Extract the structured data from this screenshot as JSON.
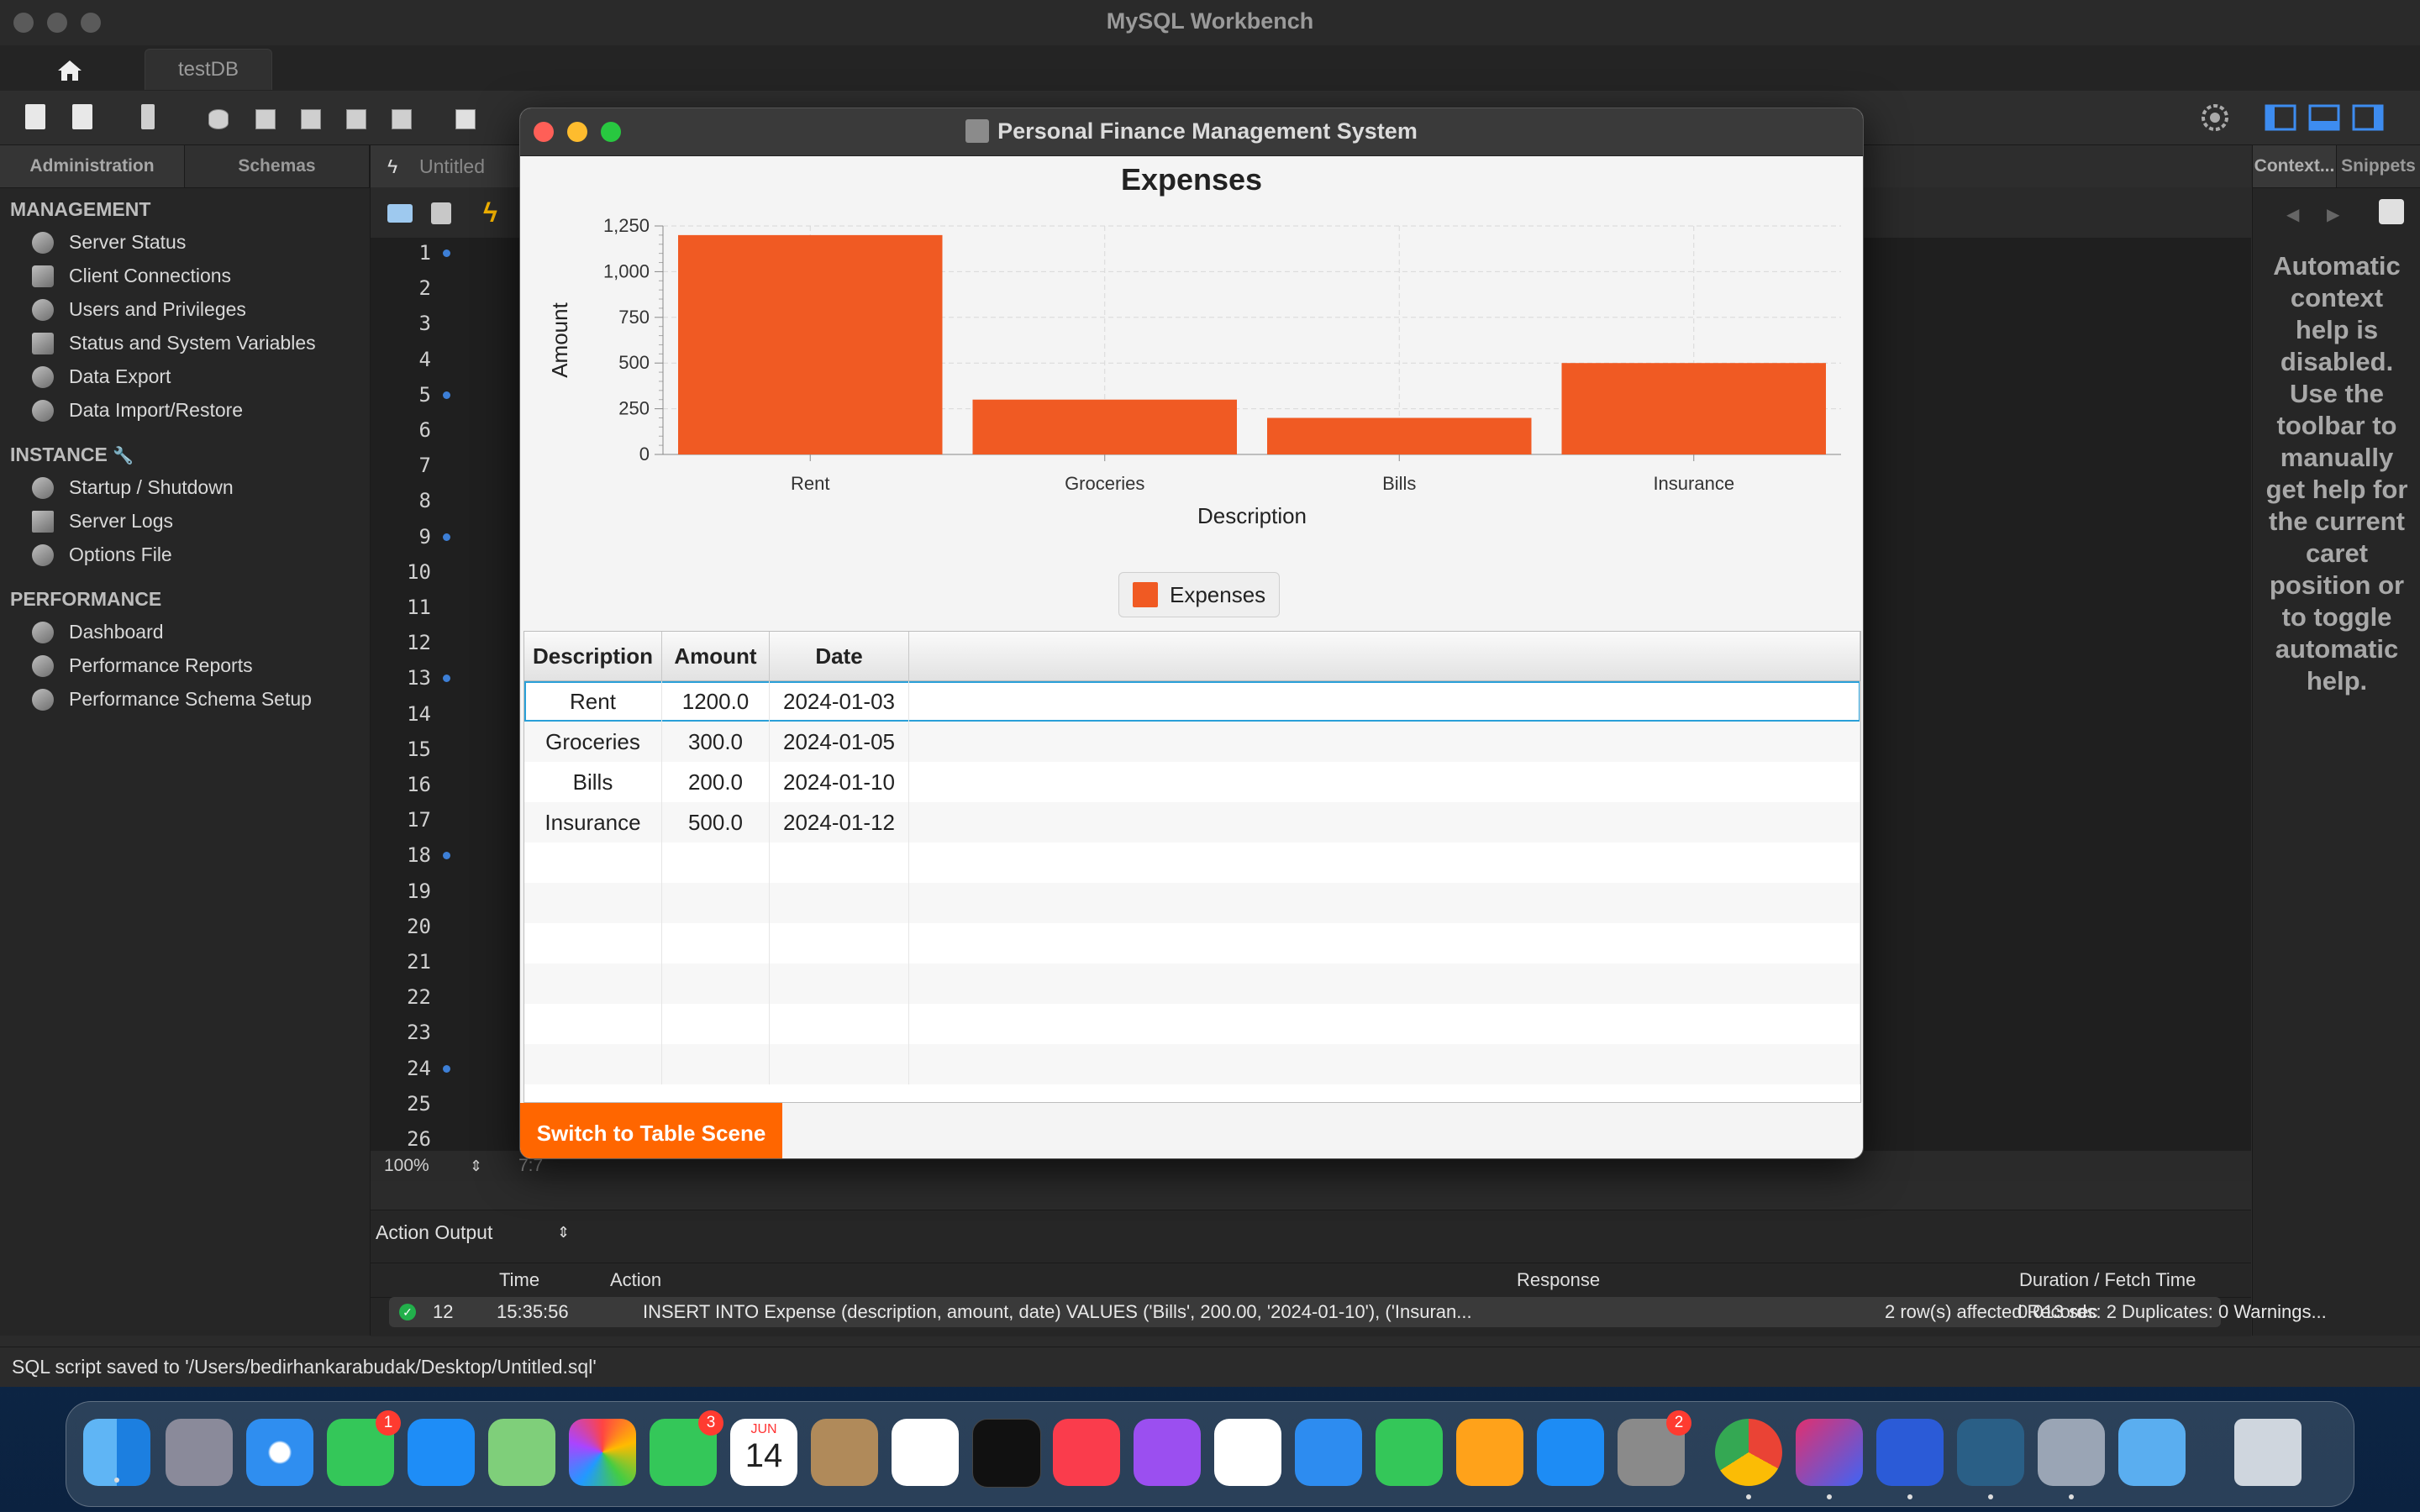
{
  "window": {
    "title": "MySQL Workbench",
    "connection_tab": "testDB"
  },
  "sidebar": {
    "tabs": [
      "Administration",
      "Schemas"
    ],
    "management_title": "MANAGEMENT",
    "management": [
      "Server Status",
      "Client Connections",
      "Users and Privileges",
      "Status and System Variables",
      "Data Export",
      "Data Import/Restore"
    ],
    "instance_title": "INSTANCE",
    "instance": [
      "Startup / Shutdown",
      "Server Logs",
      "Options File"
    ],
    "performance_title": "PERFORMANCE",
    "performance": [
      "Dashboard",
      "Performance Reports",
      "Performance Schema Setup"
    ]
  },
  "editor": {
    "tab_label": "Untitled",
    "line_numbers": [
      "1",
      "2",
      "3",
      "4",
      "5",
      "6",
      "7",
      "8",
      "9",
      "10",
      "11",
      "12",
      "13",
      "14",
      "15",
      "16",
      "17",
      "18",
      "19",
      "20",
      "21",
      "22",
      "23",
      "24",
      "25",
      "26"
    ],
    "zoom": "100%",
    "cursor_pos": "7:7"
  },
  "right_panel": {
    "tabs": [
      "Context...",
      "Snippets"
    ],
    "help_text": "Automatic context help is disabled. Use the toolbar to manually get help for the current caret position or to toggle automatic help."
  },
  "output": {
    "mode": "Action Output",
    "columns": {
      "time": "Time",
      "action": "Action",
      "response": "Response",
      "duration": "Duration / Fetch Time"
    },
    "row": {
      "num": "12",
      "time": "15:35:56",
      "action": "INSERT INTO Expense (description, amount, date) VALUES  ('Bills', 200.00, '2024-01-10'), ('Insuran...",
      "response": "2 row(s) affected Records: 2  Duplicates: 0  Warnings...",
      "duration": "0.013 sec"
    }
  },
  "status_bar": "SQL script saved to '/Users/bedirhankarabudak/Desktop/Untitled.sql'",
  "dialog": {
    "title": "Personal Finance Management System",
    "button_label": "Switch to Table Scene"
  },
  "chart_data": {
    "type": "bar",
    "title": "Expenses",
    "xlabel": "Description",
    "ylabel": "Amount",
    "categories": [
      "Rent",
      "Groceries",
      "Bills",
      "Insurance"
    ],
    "series": [
      {
        "name": "Expenses",
        "values": [
          1200,
          300,
          200,
          500
        ]
      }
    ],
    "ylim": [
      0,
      1250
    ],
    "yticks": [
      "0",
      "250",
      "500",
      "750",
      "1,000",
      "1,250"
    ],
    "grid": true,
    "legend": "bottom-center",
    "color": "#f05a23"
  },
  "table": {
    "columns": [
      "Description",
      "Amount",
      "Date"
    ],
    "rows": [
      [
        "Rent",
        "1200.0",
        "2024-01-03"
      ],
      [
        "Groceries",
        "300.0",
        "2024-01-05"
      ],
      [
        "Bills",
        "200.0",
        "2024-01-10"
      ],
      [
        "Insurance",
        "500.0",
        "2024-01-12"
      ]
    ]
  },
  "dock": {
    "messages_badge": "1",
    "facetime_badge": "3",
    "calendar_month": "JUN",
    "calendar_day": "14",
    "settings_badge": "2"
  }
}
